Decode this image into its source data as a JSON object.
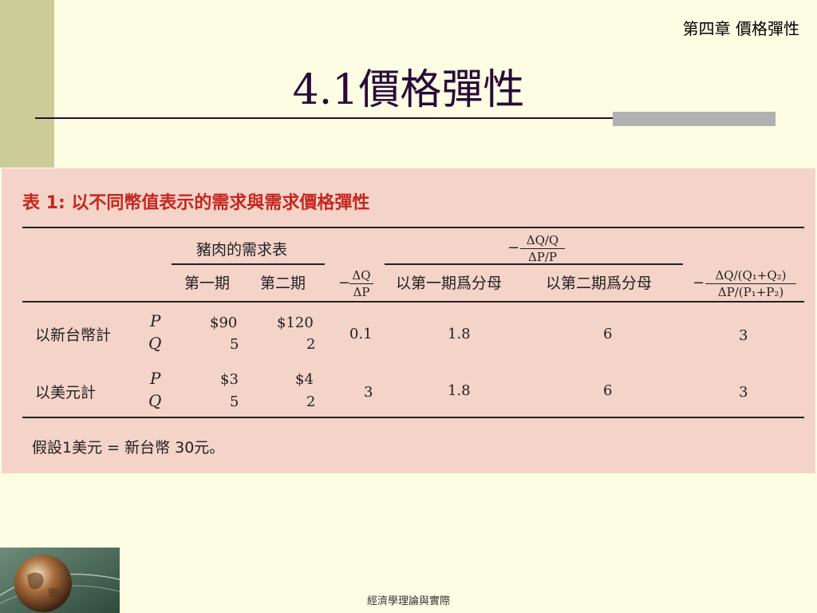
{
  "slide": {
    "chapter": "第四章 價格彈性",
    "title": "4.1價格彈性",
    "footer": "經濟學理論與實際"
  },
  "table": {
    "caption": "表 1: 以不同幣值表示的需求與需求價格彈性",
    "header": {
      "demand_schedule": "豬肉的需求表",
      "period1": "第一期",
      "period2": "第二期",
      "elasticity_top": "ΔQ/Q",
      "elasticity_bottom": "ΔP/P",
      "base_period1": "以第一期爲分母",
      "base_period2": "以第二期爲分母",
      "slope_top": "ΔQ",
      "slope_bottom": "ΔP",
      "midpoint_top": "ΔQ/(Q₁+Q₂)",
      "midpoint_bottom": "ΔP/(P₁+P₂)",
      "minus": "−"
    },
    "rows": [
      {
        "label": "以新台幣計",
        "p_symbol": "P",
        "q_symbol": "Q",
        "p1": "$90",
        "p2": "$120",
        "q1": "5",
        "q2": "2",
        "slope": "0.1",
        "e1": "1.8",
        "e2": "6",
        "mid": "3"
      },
      {
        "label": "以美元計",
        "p_symbol": "P",
        "q_symbol": "Q",
        "p1": "$3",
        "p2": "$4",
        "q1": "5",
        "q2": "2",
        "slope": "3",
        "e1": "1.8",
        "e2": "6",
        "mid": "3"
      }
    ],
    "footnote": "假設1美元 = 新台幣 30元。"
  },
  "colors": {
    "background": "#fdfde3",
    "accent_band": "#cccc99",
    "title": "#2a0a3a",
    "table_bg": "#f4d3c8",
    "caption": "#c4271f"
  },
  "icons": {
    "logo": "globe-icon"
  }
}
